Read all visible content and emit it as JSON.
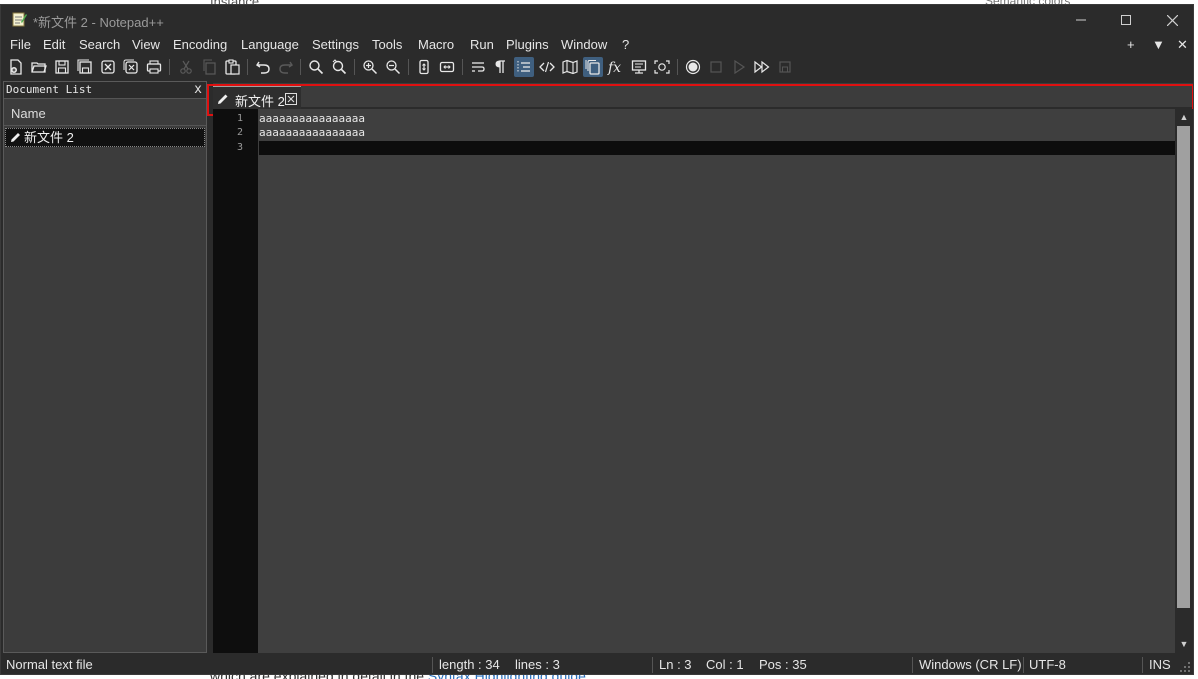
{
  "background": {
    "top_text": "Instance",
    "top_right_text": "Semantic colors",
    "bottom_text": "which are explained in detail in the ",
    "bottom_link": "Syntax Highlighting guide"
  },
  "window": {
    "title": "*新文件 2 - Notepad++",
    "controls": {
      "minimize": "minimize",
      "maximize": "maximize",
      "close": "close"
    }
  },
  "menu": {
    "items": [
      "File",
      "Edit",
      "Search",
      "View",
      "Encoding",
      "Language",
      "Settings",
      "Tools",
      "Macro",
      "Run",
      "Plugins",
      "Window",
      "?"
    ],
    "right": [
      "+",
      "▼",
      "✕"
    ]
  },
  "doclist": {
    "title": "Document List",
    "close": "x",
    "column": "Name",
    "files": [
      "新文件 2"
    ]
  },
  "tabs": [
    {
      "label": "新文件 2",
      "modified": true
    }
  ],
  "editor": {
    "lines": [
      "aaaaaaaaaaaaaaaa",
      "aaaaaaaaaaaaaaaa",
      ""
    ],
    "line_numbers": [
      "1",
      "2",
      "3"
    ],
    "current_line": 3
  },
  "status": {
    "file_type": "Normal text file",
    "length": "length : 34",
    "lines": "lines : 3",
    "ln": "Ln : 3",
    "col": "Col : 1",
    "pos": "Pos : 35",
    "eol": "Windows (CR LF)",
    "encoding": "UTF-8",
    "mode": "INS"
  },
  "colors": {
    "chrome": "#2b2b2b",
    "editor_bg": "#3f3f3f",
    "gutter_bg": "#0e0e0e",
    "highlight": "#e01010"
  }
}
